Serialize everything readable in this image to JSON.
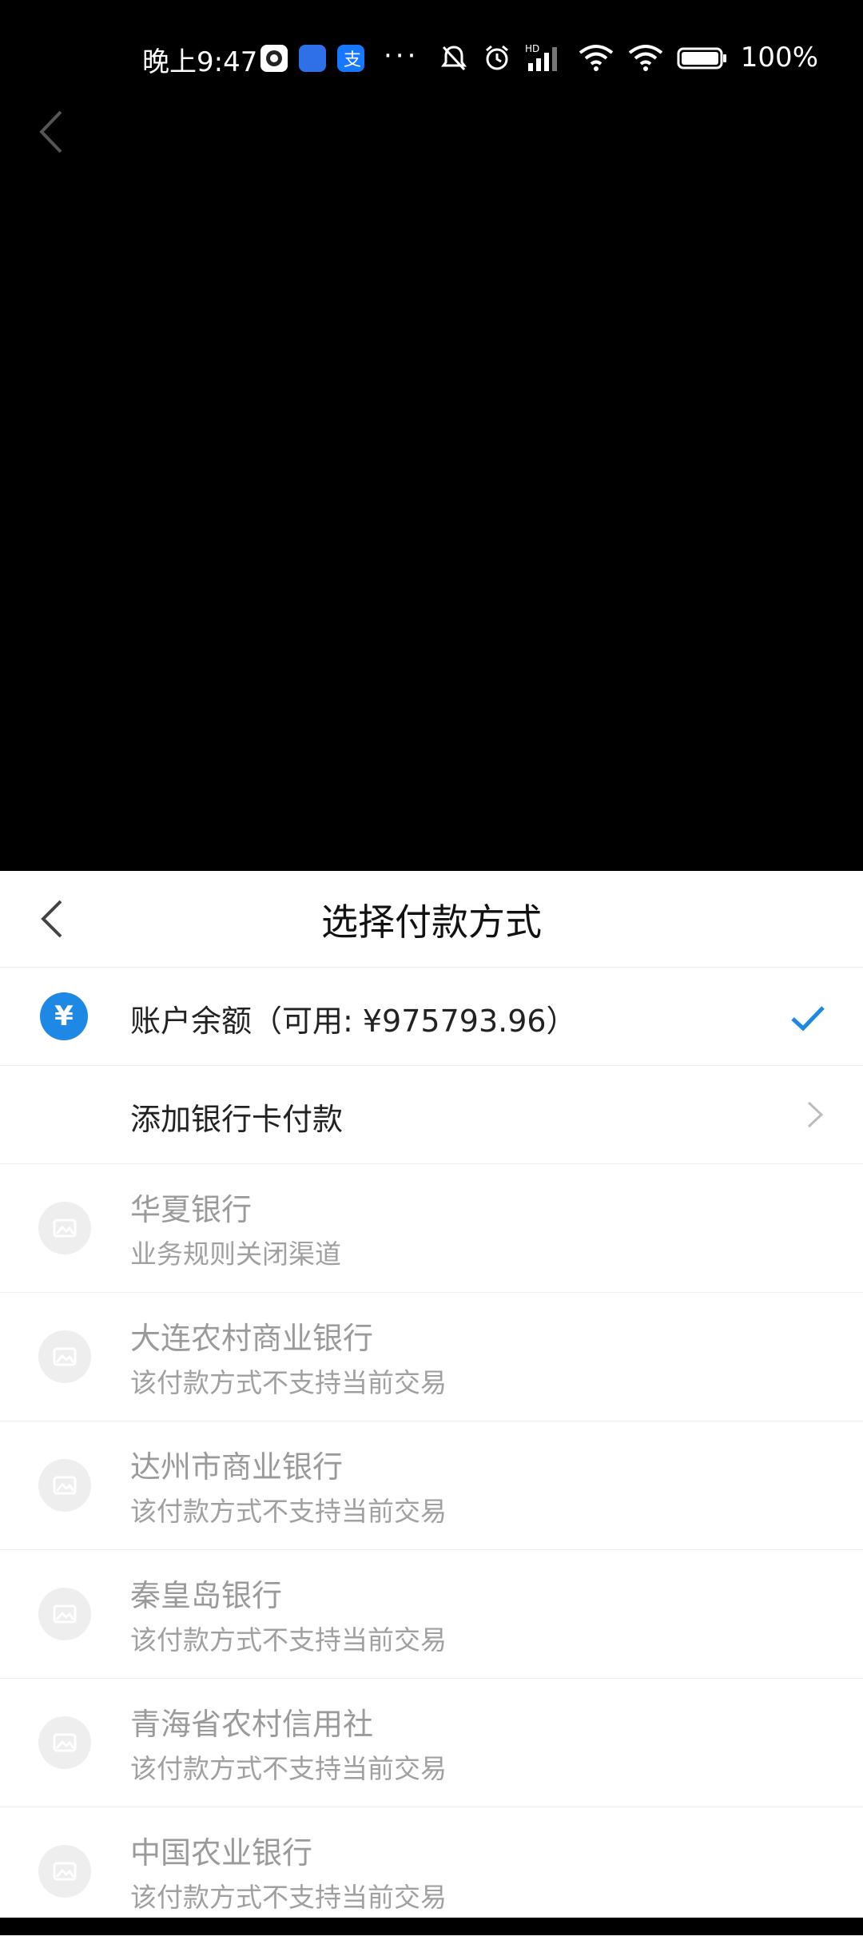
{
  "status_bar": {
    "time": "晚上9:47",
    "battery": "100%",
    "icons": [
      "app-icon-dark",
      "app-icon-autohome",
      "alipay-icon",
      "more-dots",
      "mute-icon",
      "alarm-icon",
      "hd-signal-icon",
      "wifi-icon",
      "wifi-icon",
      "battery-icon"
    ]
  },
  "sheet": {
    "title": "选择付款方式",
    "balance": {
      "label": "账户余额（可用: ¥975793.96）",
      "icon": "yen",
      "selected": true
    },
    "add_card": {
      "label": "添加银行卡付款"
    },
    "banks": [
      {
        "name": "华夏银行",
        "reason": "业务规则关闭渠道"
      },
      {
        "name": "大连农村商业银行",
        "reason": "该付款方式不支持当前交易"
      },
      {
        "name": "达州市商业银行",
        "reason": "该付款方式不支持当前交易"
      },
      {
        "name": "秦皇岛银行",
        "reason": "该付款方式不支持当前交易"
      },
      {
        "name": "青海省农村信用社",
        "reason": "该付款方式不支持当前交易"
      },
      {
        "name": "中国农业银行",
        "reason": "该付款方式不支持当前交易"
      }
    ]
  },
  "colors": {
    "accent": "#1e88e5",
    "disabled_text": "#9a9a9a",
    "background_top": "#000000",
    "sheet_bg": "#ffffff"
  }
}
